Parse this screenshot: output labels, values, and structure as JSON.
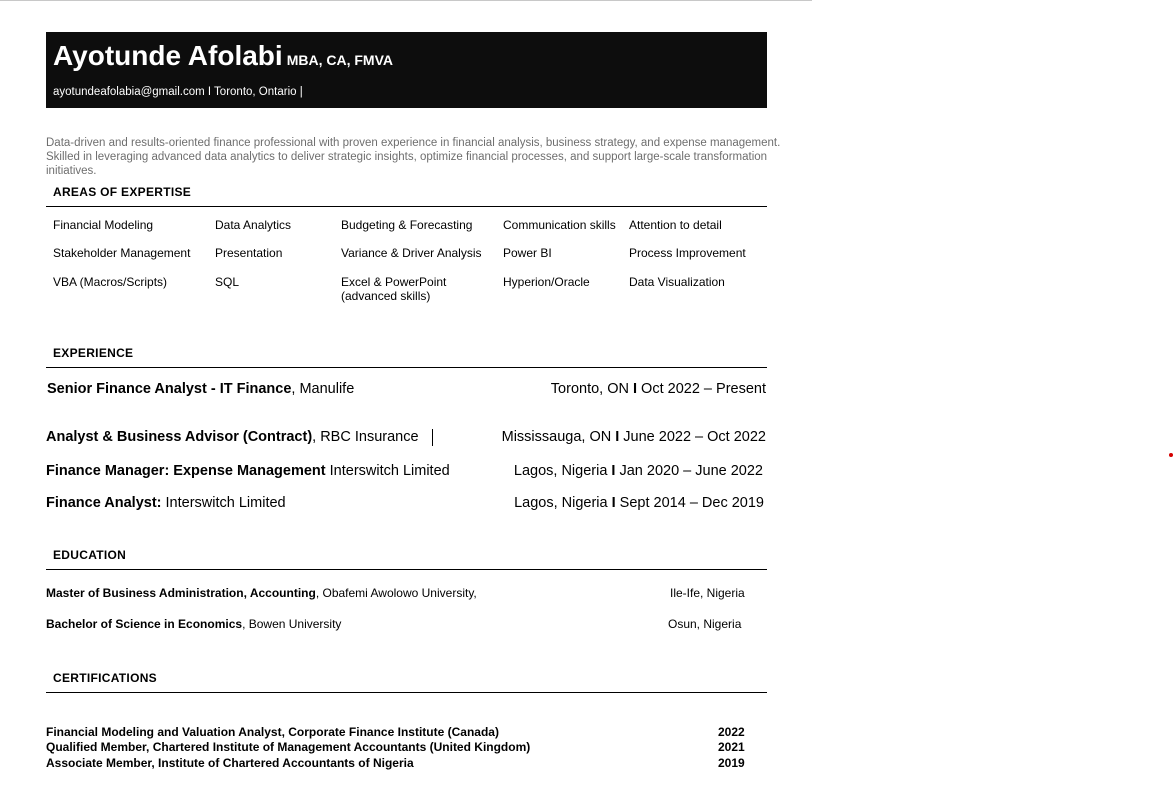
{
  "header": {
    "name": "Ayotunde Afolabi",
    "credentials": "MBA, CA, FMVA",
    "contact": "ayotundeafolabia@gmail.com I Toronto, Ontario |"
  },
  "summary": "Data-driven and results-oriented finance professional with proven experience in financial analysis, business strategy, and expense management. Skilled in leveraging advanced data analytics to deliver strategic insights, optimize financial processes, and support large-scale transformation initiatives.",
  "expertise": {
    "title": "AREAS OF EXPERTISE",
    "items": [
      "Financial Modeling",
      "Data Analytics",
      "Budgeting & Forecasting",
      "Communication skills",
      "Attention to detail",
      "Stakeholder Management",
      "Presentation",
      "Variance & Driver Analysis",
      "Power BI",
      "Process Improvement",
      "VBA (Macros/Scripts)",
      "SQL",
      "Excel & PowerPoint (advanced skills)",
      "Hyperion/Oracle",
      "Data Visualization"
    ]
  },
  "experience": {
    "title": "EXPERIENCE",
    "jobs": [
      {
        "role": "Senior Finance Analyst - IT Finance",
        "company": ", Manulife",
        "location": "Toronto, ON ",
        "sep": "I",
        "dates": " Oct 2022 – Present"
      },
      {
        "role": "Analyst & Business Advisor (Contract)",
        "company": ", RBC Insurance",
        "location": "Mississauga, ON ",
        "sep": "I",
        "dates": " June 2022 – Oct 2022"
      },
      {
        "role": "Finance Manager: Expense Management",
        "company": " Interswitch Limited",
        "location": "Lagos, Nigeria ",
        "sep": "I",
        "dates": " Jan 2020 – June 2022"
      },
      {
        "role": "Finance Analyst:",
        "company": " Interswitch Limited",
        "location": "Lagos, Nigeria ",
        "sep": "I",
        "dates": " Sept 2014 – Dec 2019"
      }
    ]
  },
  "education": {
    "title": "EDUCATION",
    "items": [
      {
        "degree": "Master of Business Administration, Accounting",
        "school": ", Obafemi Awolowo University,",
        "location": "Ile-Ife, Nigeria"
      },
      {
        "degree": "Bachelor of Science in Economics",
        "school": ", Bowen University",
        "location": "Osun, Nigeria"
      }
    ]
  },
  "certifications": {
    "title": "CERTIFICATIONS",
    "items": [
      {
        "name": "Financial Modeling and Valuation Analyst, Corporate Finance Institute (Canada)",
        "year": "2022"
      },
      {
        "name": "Qualified Member, Chartered Institute of Management Accountants (United Kingdom)",
        "year": "2021"
      },
      {
        "name": "Associate Member, Institute of Chartered Accountants of Nigeria",
        "year": "2019"
      }
    ]
  }
}
